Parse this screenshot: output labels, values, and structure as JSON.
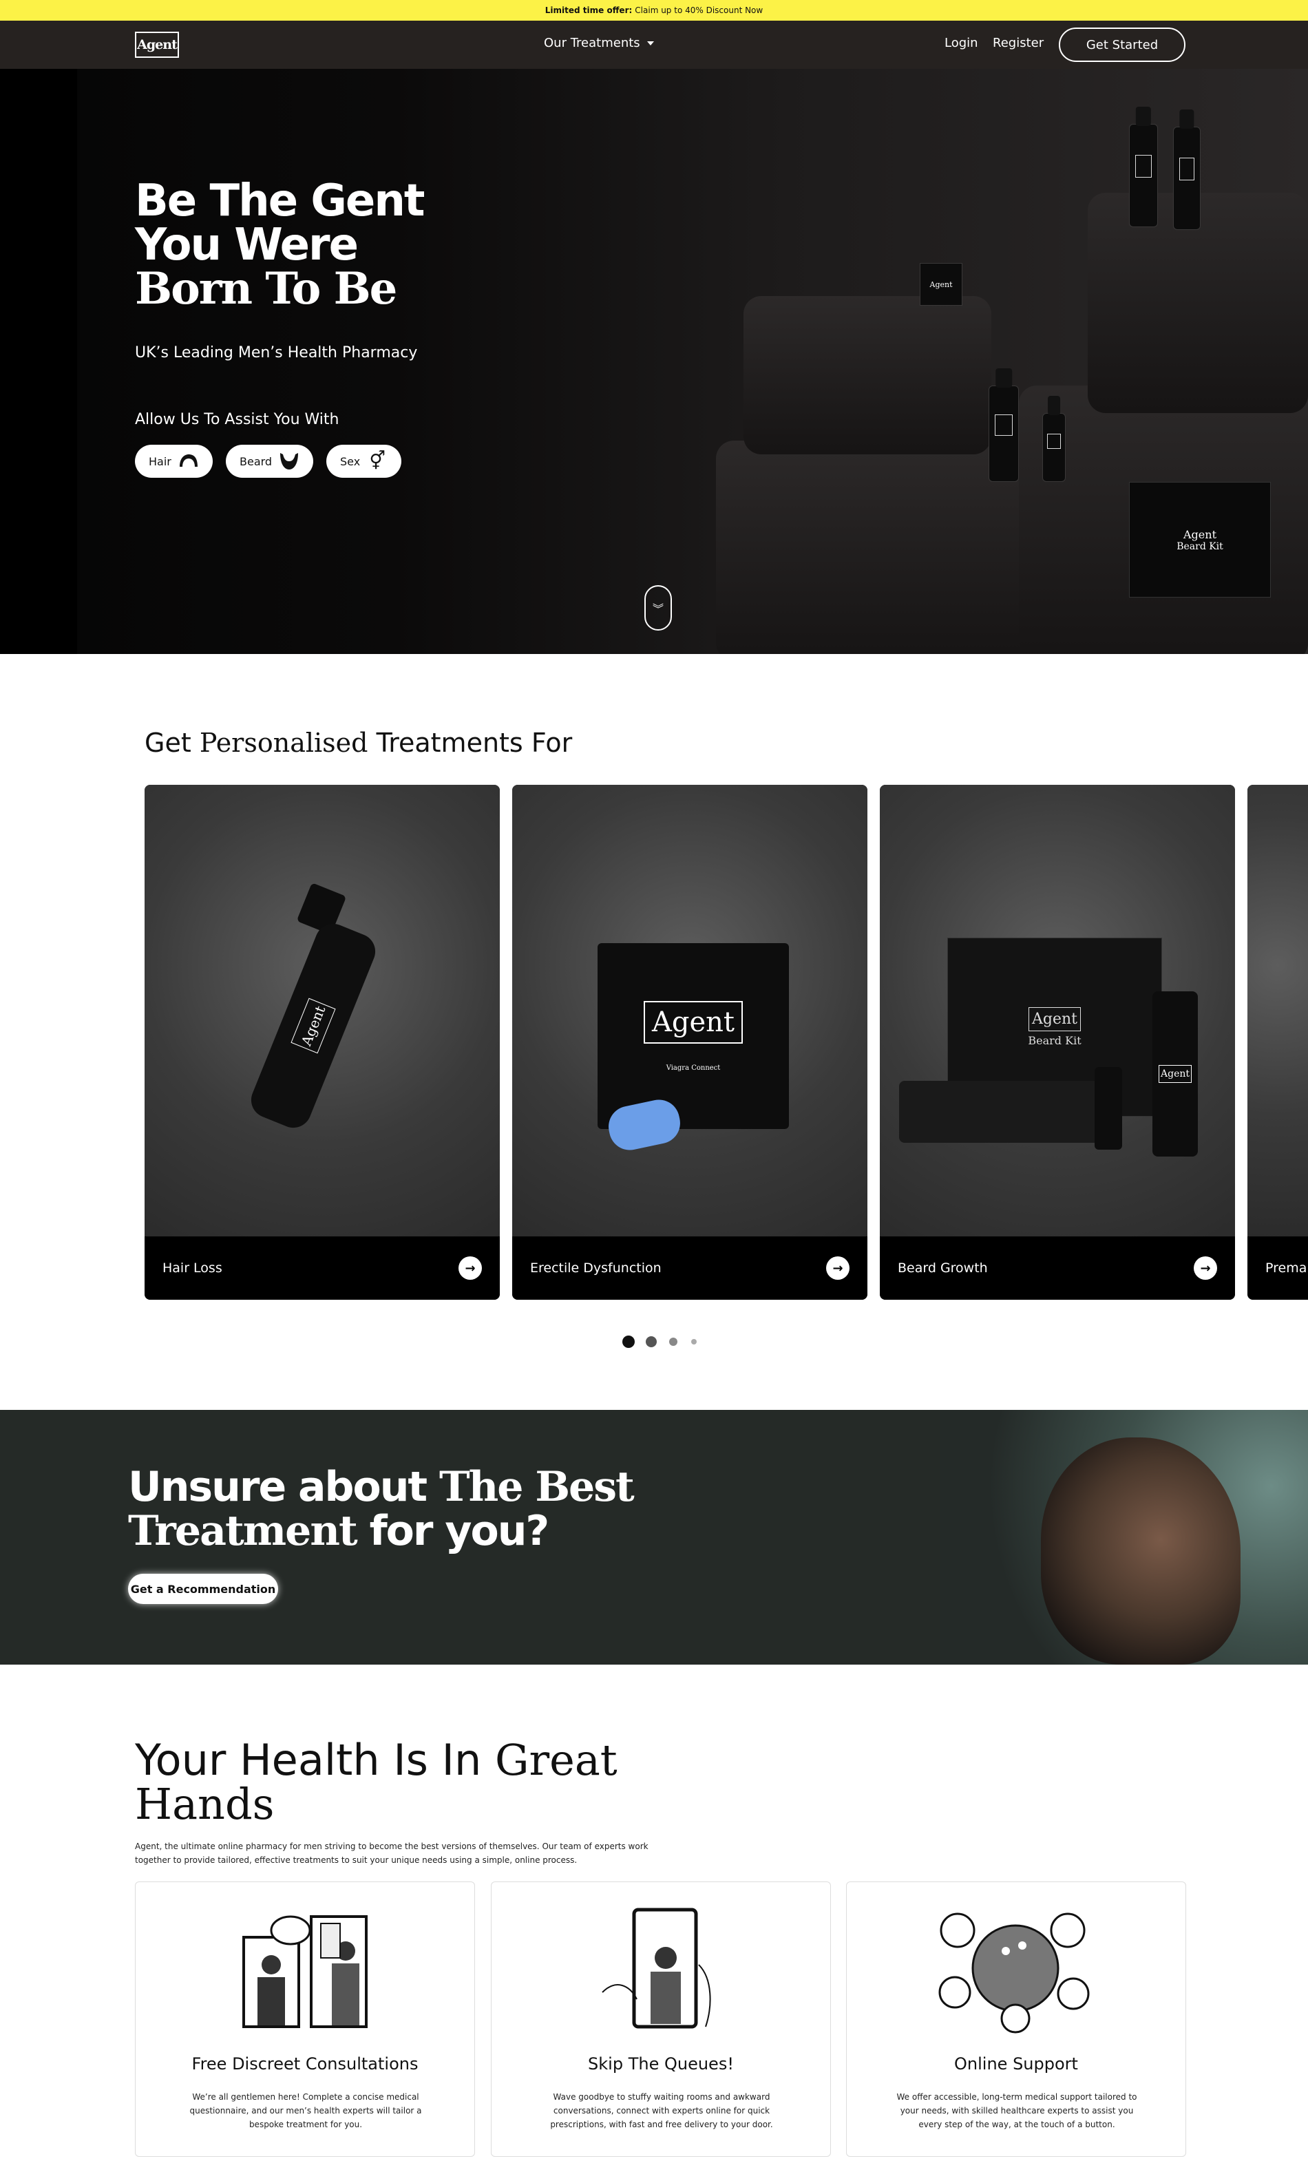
{
  "promo": {
    "bold": "Limited time offer:",
    "text": "Claim up to 40% Discount Now"
  },
  "nav": {
    "logo": "Agent",
    "treatments": "Our Treatments",
    "login": "Login",
    "register": "Register",
    "get_started": "Get Started"
  },
  "hero": {
    "title_line1": "Be The Gent",
    "title_line2": "You Were",
    "title_line3": "Born To Be",
    "subtitle": "UK’s Leading Men’s Health Pharmacy",
    "assist": "Allow Us To Assist You With",
    "chips": [
      {
        "label": "Hair",
        "icon": "hair-icon"
      },
      {
        "label": "Beard",
        "icon": "beard-icon"
      },
      {
        "label": "Sex",
        "icon": "sex-symbol-icon"
      }
    ],
    "product_labels": {
      "box": "Agent",
      "kit_brand": "Agent",
      "kit_name": "Beard Kit"
    }
  },
  "treatments": {
    "title_pre": "Get",
    "title_em": "Personalised",
    "title_post": "Treatments For",
    "cards": [
      {
        "label": "Hair Loss",
        "bottle_label": "Agent"
      },
      {
        "label": "Erectile Dysfunction",
        "pack_label": "Agent",
        "pack_sub": "Viagra Connect"
      },
      {
        "label": "Beard Growth",
        "box_label": "Agent",
        "box_sub": "Beard Kit",
        "bottle_label": "Agent"
      },
      {
        "label": "Prema"
      }
    ],
    "pagination": {
      "pages": 4,
      "active": 0
    }
  },
  "unsure": {
    "line1_plain": "Unsure about",
    "line1_em": "The Best",
    "line2_em": "Treatment",
    "line2_plain": "for you?",
    "button": "Get a Recommendation"
  },
  "health": {
    "title_plain": "Your Health Is In",
    "title_em1": "Great",
    "title_em2": "Hands",
    "description": "Agent, the ultimate online pharmacy for men striving to become the best versions of themselves. Our team of experts work together to provide tailored, effective treatments to suit your unique needs using a simple, online process.",
    "features": [
      {
        "title": "Free Discreet Consultations",
        "text": "We’re all gentlemen here! Complete a concise medical questionnaire, and our men’s health experts will tailor a bespoke treatment for you."
      },
      {
        "title": "Skip The Queues!",
        "text": "Wave goodbye to stuffy waiting rooms and awkward conversations, connect with experts online for quick prescriptions, with fast and free delivery to your door."
      },
      {
        "title": "Online Support",
        "text": "We offer accessible, long-term medical support tailored to your needs, with skilled healthcare experts to assist you every step of the way, at the touch of a button."
      }
    ]
  }
}
